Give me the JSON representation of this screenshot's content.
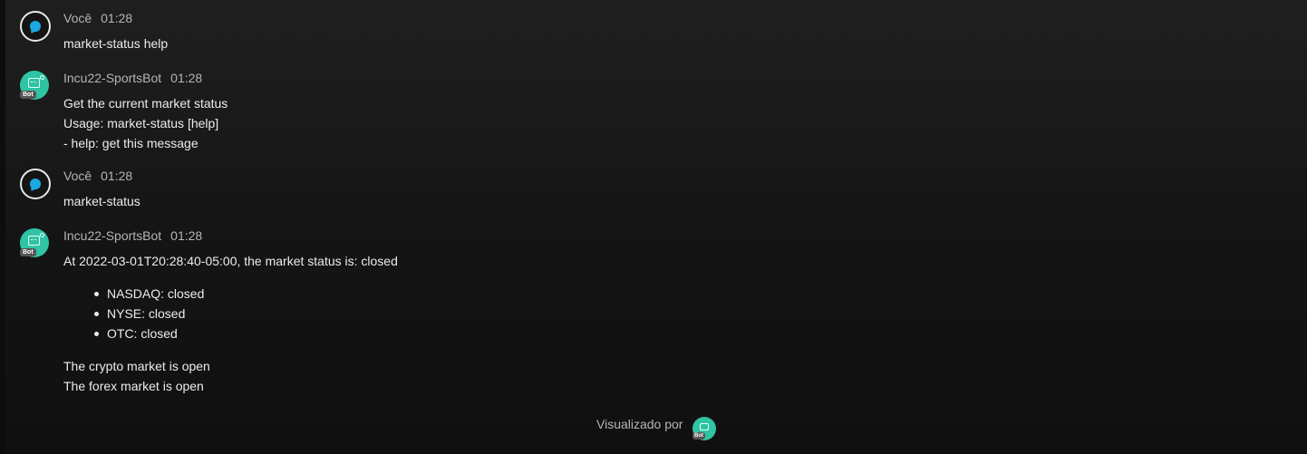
{
  "messages": [
    {
      "author": "Você",
      "time": "01:28",
      "lines": [
        "market-status help"
      ]
    },
    {
      "author": "Incu22-SportsBot",
      "time": "01:28",
      "badge": "Bot",
      "lines": [
        "Get the current market status",
        "Usage: market-status [help]",
        "- help: get this message"
      ]
    },
    {
      "author": "Você",
      "time": "01:28",
      "lines": [
        "market-status"
      ]
    },
    {
      "author": "Incu22-SportsBot",
      "time": "01:28",
      "badge": "Bot",
      "intro": "At 2022-03-01T20:28:40-05:00, the market status is: closed",
      "list": [
        "NASDAQ: closed",
        "NYSE: closed",
        "OTC: closed"
      ],
      "outro": [
        "The crypto market is open",
        "The forex market is open"
      ]
    }
  ],
  "read_receipt": {
    "label": "Visualizado por",
    "badge": "Bot"
  },
  "colors": {
    "bot_avatar": "#2ec4a4",
    "user_icon": "#1aa9e0"
  },
  "icons": {
    "user": "chat-bubble-icon",
    "bot": "robot-icon"
  }
}
